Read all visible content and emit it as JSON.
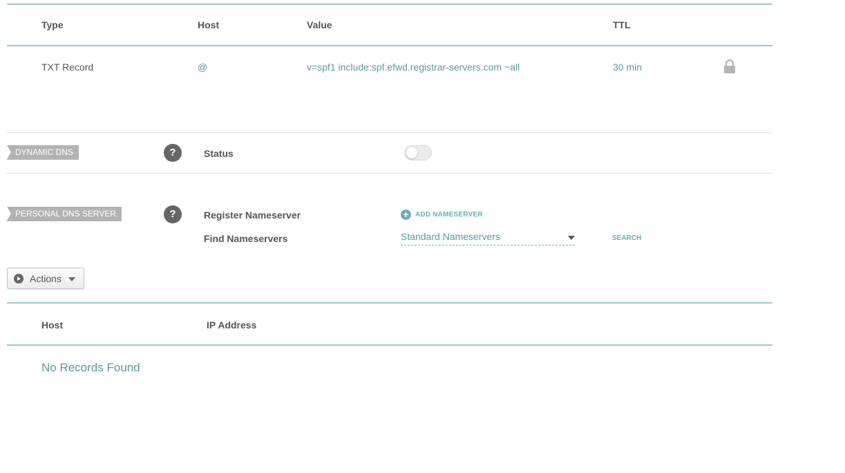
{
  "records_table": {
    "headers": {
      "type": "Type",
      "host": "Host",
      "value": "Value",
      "ttl": "TTL"
    },
    "rows": [
      {
        "type": "TXT Record",
        "host": "@",
        "value": "v=spf1 include:spf.efwd.registrar-servers.com ~all",
        "ttl": "30 min",
        "icon": "lock-icon"
      }
    ]
  },
  "dynamic_dns": {
    "tag": "DYNAMIC DNS",
    "help": "?",
    "status_label": "Status",
    "status_enabled": false
  },
  "personal_dns": {
    "tag": "PERSONAL DNS SERVER",
    "help": "?",
    "register_label": "Register Nameserver",
    "add_nameserver": "ADD NAMESERVER",
    "find_label": "Find Nameservers",
    "select_value": "Standard Nameservers",
    "search": "SEARCH"
  },
  "actions": {
    "label": "Actions"
  },
  "nameserver_table": {
    "headers": {
      "host": "Host",
      "ip": "IP Address"
    },
    "empty_message": "No Records Found"
  },
  "colors": {
    "accent": "#5b9a9f",
    "divider": "#9ccbcb",
    "tag": "#b3b3b3"
  }
}
